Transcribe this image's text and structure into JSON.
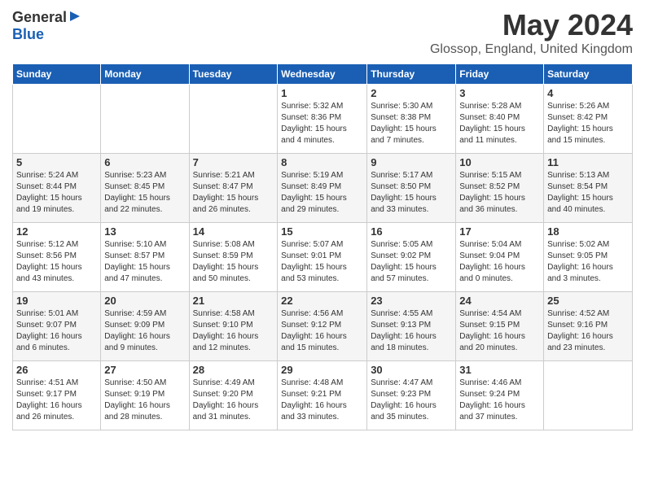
{
  "header": {
    "logo_general": "General",
    "logo_blue": "Blue",
    "month": "May 2024",
    "location": "Glossop, England, United Kingdom"
  },
  "days_of_week": [
    "Sunday",
    "Monday",
    "Tuesday",
    "Wednesday",
    "Thursday",
    "Friday",
    "Saturday"
  ],
  "weeks": [
    [
      {
        "num": "",
        "detail": ""
      },
      {
        "num": "",
        "detail": ""
      },
      {
        "num": "",
        "detail": ""
      },
      {
        "num": "1",
        "detail": "Sunrise: 5:32 AM\nSunset: 8:36 PM\nDaylight: 15 hours\nand 4 minutes."
      },
      {
        "num": "2",
        "detail": "Sunrise: 5:30 AM\nSunset: 8:38 PM\nDaylight: 15 hours\nand 7 minutes."
      },
      {
        "num": "3",
        "detail": "Sunrise: 5:28 AM\nSunset: 8:40 PM\nDaylight: 15 hours\nand 11 minutes."
      },
      {
        "num": "4",
        "detail": "Sunrise: 5:26 AM\nSunset: 8:42 PM\nDaylight: 15 hours\nand 15 minutes."
      }
    ],
    [
      {
        "num": "5",
        "detail": "Sunrise: 5:24 AM\nSunset: 8:44 PM\nDaylight: 15 hours\nand 19 minutes."
      },
      {
        "num": "6",
        "detail": "Sunrise: 5:23 AM\nSunset: 8:45 PM\nDaylight: 15 hours\nand 22 minutes."
      },
      {
        "num": "7",
        "detail": "Sunrise: 5:21 AM\nSunset: 8:47 PM\nDaylight: 15 hours\nand 26 minutes."
      },
      {
        "num": "8",
        "detail": "Sunrise: 5:19 AM\nSunset: 8:49 PM\nDaylight: 15 hours\nand 29 minutes."
      },
      {
        "num": "9",
        "detail": "Sunrise: 5:17 AM\nSunset: 8:50 PM\nDaylight: 15 hours\nand 33 minutes."
      },
      {
        "num": "10",
        "detail": "Sunrise: 5:15 AM\nSunset: 8:52 PM\nDaylight: 15 hours\nand 36 minutes."
      },
      {
        "num": "11",
        "detail": "Sunrise: 5:13 AM\nSunset: 8:54 PM\nDaylight: 15 hours\nand 40 minutes."
      }
    ],
    [
      {
        "num": "12",
        "detail": "Sunrise: 5:12 AM\nSunset: 8:56 PM\nDaylight: 15 hours\nand 43 minutes."
      },
      {
        "num": "13",
        "detail": "Sunrise: 5:10 AM\nSunset: 8:57 PM\nDaylight: 15 hours\nand 47 minutes."
      },
      {
        "num": "14",
        "detail": "Sunrise: 5:08 AM\nSunset: 8:59 PM\nDaylight: 15 hours\nand 50 minutes."
      },
      {
        "num": "15",
        "detail": "Sunrise: 5:07 AM\nSunset: 9:01 PM\nDaylight: 15 hours\nand 53 minutes."
      },
      {
        "num": "16",
        "detail": "Sunrise: 5:05 AM\nSunset: 9:02 PM\nDaylight: 15 hours\nand 57 minutes."
      },
      {
        "num": "17",
        "detail": "Sunrise: 5:04 AM\nSunset: 9:04 PM\nDaylight: 16 hours\nand 0 minutes."
      },
      {
        "num": "18",
        "detail": "Sunrise: 5:02 AM\nSunset: 9:05 PM\nDaylight: 16 hours\nand 3 minutes."
      }
    ],
    [
      {
        "num": "19",
        "detail": "Sunrise: 5:01 AM\nSunset: 9:07 PM\nDaylight: 16 hours\nand 6 minutes."
      },
      {
        "num": "20",
        "detail": "Sunrise: 4:59 AM\nSunset: 9:09 PM\nDaylight: 16 hours\nand 9 minutes."
      },
      {
        "num": "21",
        "detail": "Sunrise: 4:58 AM\nSunset: 9:10 PM\nDaylight: 16 hours\nand 12 minutes."
      },
      {
        "num": "22",
        "detail": "Sunrise: 4:56 AM\nSunset: 9:12 PM\nDaylight: 16 hours\nand 15 minutes."
      },
      {
        "num": "23",
        "detail": "Sunrise: 4:55 AM\nSunset: 9:13 PM\nDaylight: 16 hours\nand 18 minutes."
      },
      {
        "num": "24",
        "detail": "Sunrise: 4:54 AM\nSunset: 9:15 PM\nDaylight: 16 hours\nand 20 minutes."
      },
      {
        "num": "25",
        "detail": "Sunrise: 4:52 AM\nSunset: 9:16 PM\nDaylight: 16 hours\nand 23 minutes."
      }
    ],
    [
      {
        "num": "26",
        "detail": "Sunrise: 4:51 AM\nSunset: 9:17 PM\nDaylight: 16 hours\nand 26 minutes."
      },
      {
        "num": "27",
        "detail": "Sunrise: 4:50 AM\nSunset: 9:19 PM\nDaylight: 16 hours\nand 28 minutes."
      },
      {
        "num": "28",
        "detail": "Sunrise: 4:49 AM\nSunset: 9:20 PM\nDaylight: 16 hours\nand 31 minutes."
      },
      {
        "num": "29",
        "detail": "Sunrise: 4:48 AM\nSunset: 9:21 PM\nDaylight: 16 hours\nand 33 minutes."
      },
      {
        "num": "30",
        "detail": "Sunrise: 4:47 AM\nSunset: 9:23 PM\nDaylight: 16 hours\nand 35 minutes."
      },
      {
        "num": "31",
        "detail": "Sunrise: 4:46 AM\nSunset: 9:24 PM\nDaylight: 16 hours\nand 37 minutes."
      },
      {
        "num": "",
        "detail": ""
      }
    ]
  ]
}
